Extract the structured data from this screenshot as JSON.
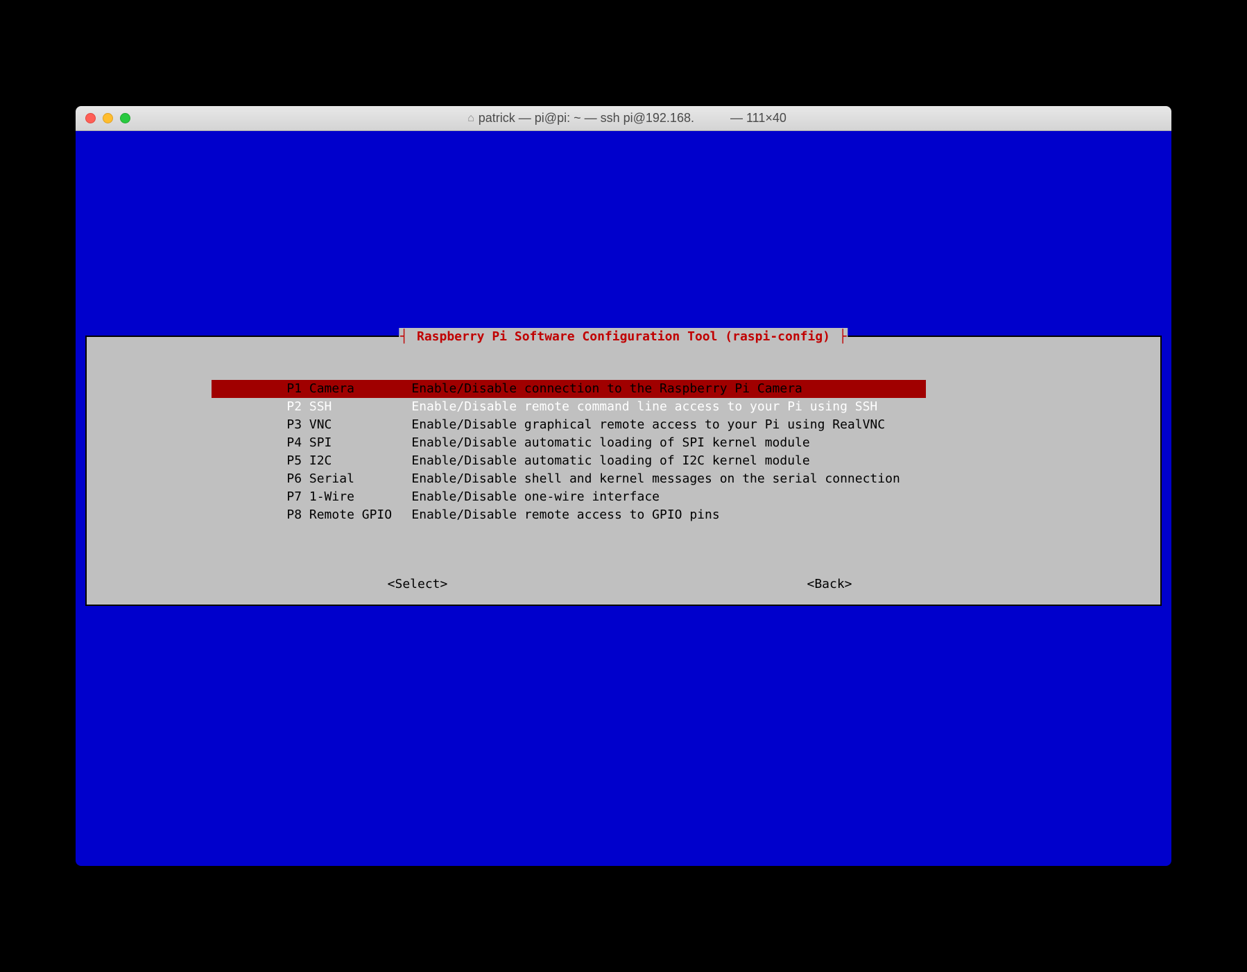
{
  "window": {
    "title_left": "patrick — pi@pi: ~ — ssh pi@192.168.",
    "title_right": "— 111×40"
  },
  "dialog": {
    "title": " Raspberry Pi Software Configuration Tool (raspi-config) ",
    "selected_index": 1,
    "items": [
      {
        "label": "P1 Camera",
        "desc": "Enable/Disable connection to the Raspberry Pi Camera"
      },
      {
        "label": "P2 SSH",
        "desc": "Enable/Disable remote command line access to your Pi using SSH"
      },
      {
        "label": "P3 VNC",
        "desc": "Enable/Disable graphical remote access to your Pi using RealVNC"
      },
      {
        "label": "P4 SPI",
        "desc": "Enable/Disable automatic loading of SPI kernel module"
      },
      {
        "label": "P5 I2C",
        "desc": "Enable/Disable automatic loading of I2C kernel module"
      },
      {
        "label": "P6 Serial",
        "desc": "Enable/Disable shell and kernel messages on the serial connection"
      },
      {
        "label": "P7 1-Wire",
        "desc": "Enable/Disable one-wire interface"
      },
      {
        "label": "P8 Remote GPIO",
        "desc": "Enable/Disable remote access to GPIO pins"
      }
    ],
    "buttons": {
      "select": "<Select>",
      "back": "<Back>"
    }
  }
}
